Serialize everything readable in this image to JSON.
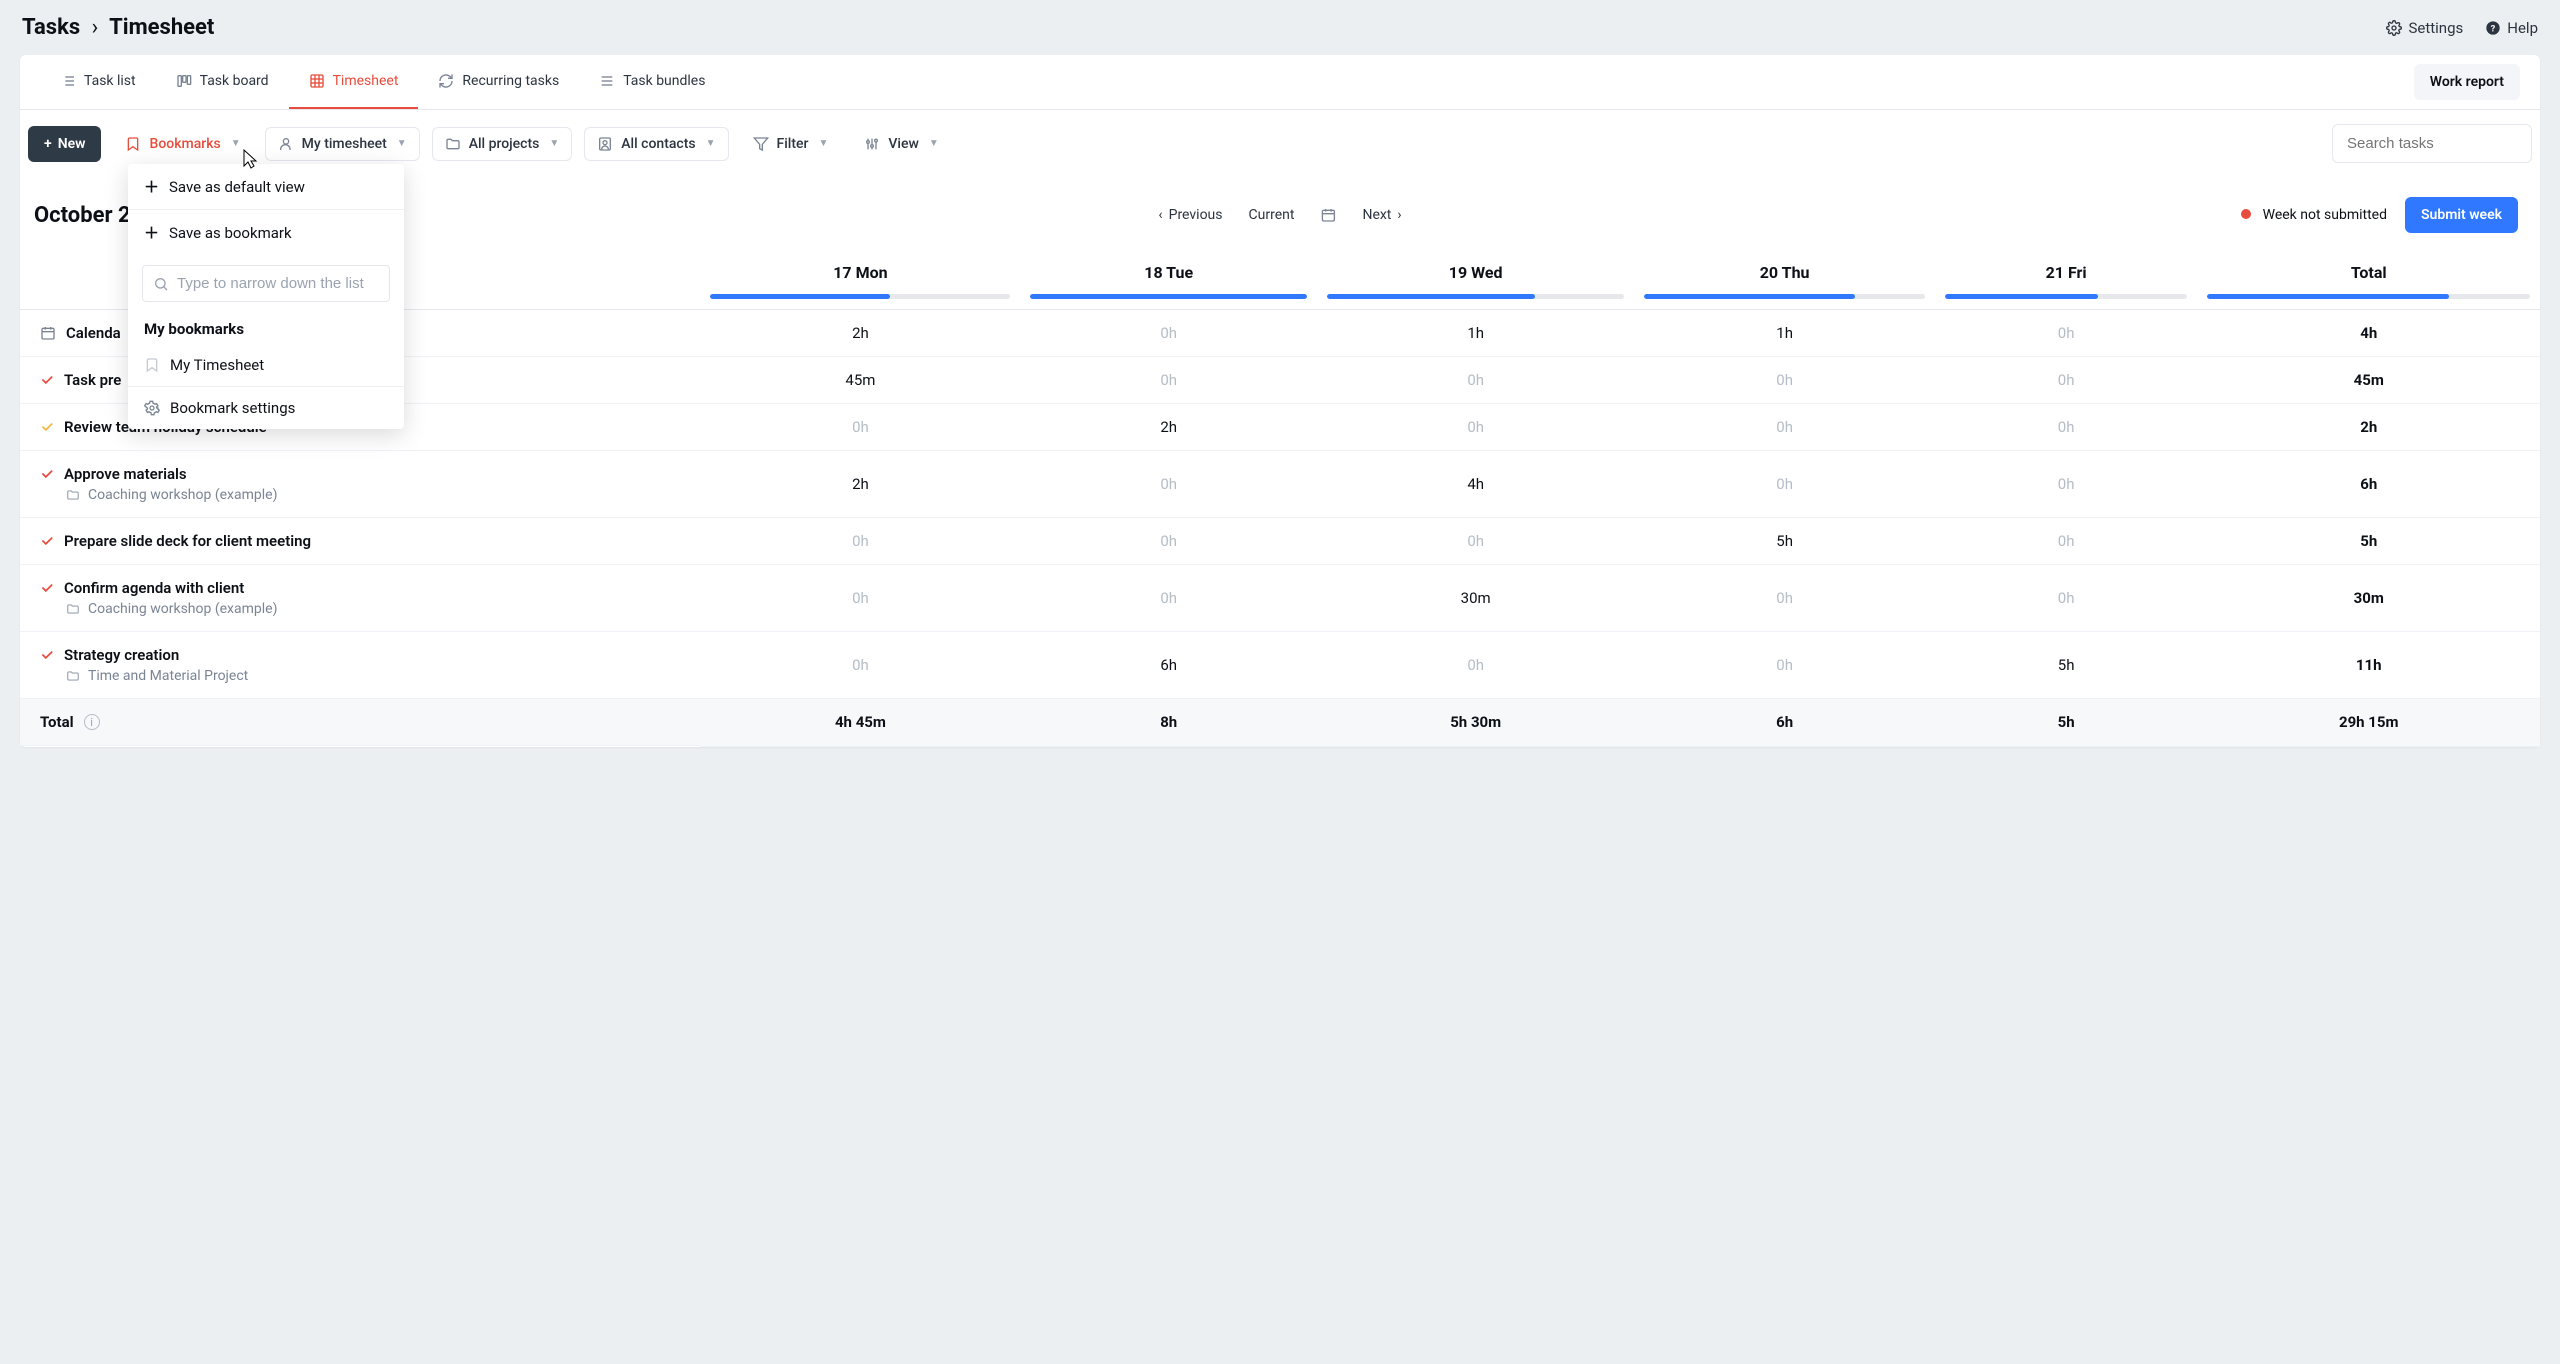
{
  "breadcrumb": {
    "root": "Tasks",
    "sep": "›",
    "current": "Timesheet"
  },
  "topnav": {
    "settings": "Settings",
    "help": "Help"
  },
  "tabs": {
    "task_list": "Task list",
    "task_board": "Task board",
    "timesheet": "Timesheet",
    "recurring": "Recurring tasks",
    "bundles": "Task bundles",
    "work_report": "Work report"
  },
  "toolbar": {
    "new": "New",
    "bookmarks": "Bookmarks",
    "my_timesheet": "My timesheet",
    "all_projects": "All projects",
    "all_contacts": "All contacts",
    "filter": "Filter",
    "view": "View",
    "search_placeholder": "Search tasks"
  },
  "dropdown": {
    "save_default": "Save as default view",
    "save_bookmark": "Save as bookmark",
    "search_placeholder": "Type to narrow down the list",
    "heading": "My bookmarks",
    "item_mytimesheet": "My Timesheet",
    "settings": "Bookmark settings"
  },
  "period": {
    "title": "October 2",
    "prev": "Previous",
    "current": "Current",
    "next": "Next",
    "status": "Week not submitted",
    "submit": "Submit week"
  },
  "columns": {
    "task": "",
    "mon": "17 Mon",
    "tue": "18 Tue",
    "wed": "19 Wed",
    "thu": "20 Thu",
    "fri": "21 Fri",
    "total": "Total"
  },
  "progress": {
    "mon": 60,
    "tue": 100,
    "wed": 70,
    "thu": 75,
    "fri": 63,
    "total": 75
  },
  "rows": [
    {
      "key": "calendar",
      "label": "Calenda",
      "icon": "calendar",
      "cells": [
        "2h",
        "0h",
        "1h",
        "1h",
        "0h",
        "4h"
      ],
      "zero": [
        false,
        true,
        false,
        false,
        true,
        false
      ]
    },
    {
      "key": "task_pre",
      "label": "Task pre",
      "icon": "check-red",
      "cells": [
        "45m",
        "0h",
        "0h",
        "0h",
        "0h",
        "45m"
      ],
      "zero": [
        false,
        true,
        true,
        true,
        true,
        false
      ]
    },
    {
      "key": "review",
      "label": "Review team holiday schedule",
      "icon": "check-yellow",
      "cells": [
        "0h",
        "2h",
        "0h",
        "0h",
        "0h",
        "2h"
      ],
      "zero": [
        true,
        false,
        true,
        true,
        true,
        false
      ]
    },
    {
      "key": "approve",
      "label": "Approve materials",
      "sub": "Coaching workshop (example)",
      "icon": "check-red",
      "cells": [
        "2h",
        "0h",
        "4h",
        "0h",
        "0h",
        "6h"
      ],
      "zero": [
        false,
        true,
        false,
        true,
        true,
        false
      ]
    },
    {
      "key": "slide",
      "label": "Prepare slide deck for client meeting",
      "icon": "check-red",
      "cells": [
        "0h",
        "0h",
        "0h",
        "5h",
        "0h",
        "5h"
      ],
      "zero": [
        true,
        true,
        true,
        false,
        true,
        false
      ]
    },
    {
      "key": "confirm",
      "label": "Confirm agenda with client",
      "sub": "Coaching workshop (example)",
      "icon": "check-red",
      "cells": [
        "0h",
        "0h",
        "30m",
        "0h",
        "0h",
        "30m"
      ],
      "zero": [
        true,
        true,
        false,
        true,
        true,
        false
      ]
    },
    {
      "key": "strategy",
      "label": "Strategy creation",
      "sub": "Time and Material Project",
      "icon": "check-red",
      "cells": [
        "0h",
        "6h",
        "0h",
        "0h",
        "5h",
        "11h"
      ],
      "zero": [
        true,
        false,
        true,
        true,
        false,
        false
      ]
    }
  ],
  "totals": {
    "label": "Total",
    "cells": [
      "4h 45m",
      "8h",
      "5h 30m",
      "6h",
      "5h",
      "29h 15m"
    ]
  }
}
